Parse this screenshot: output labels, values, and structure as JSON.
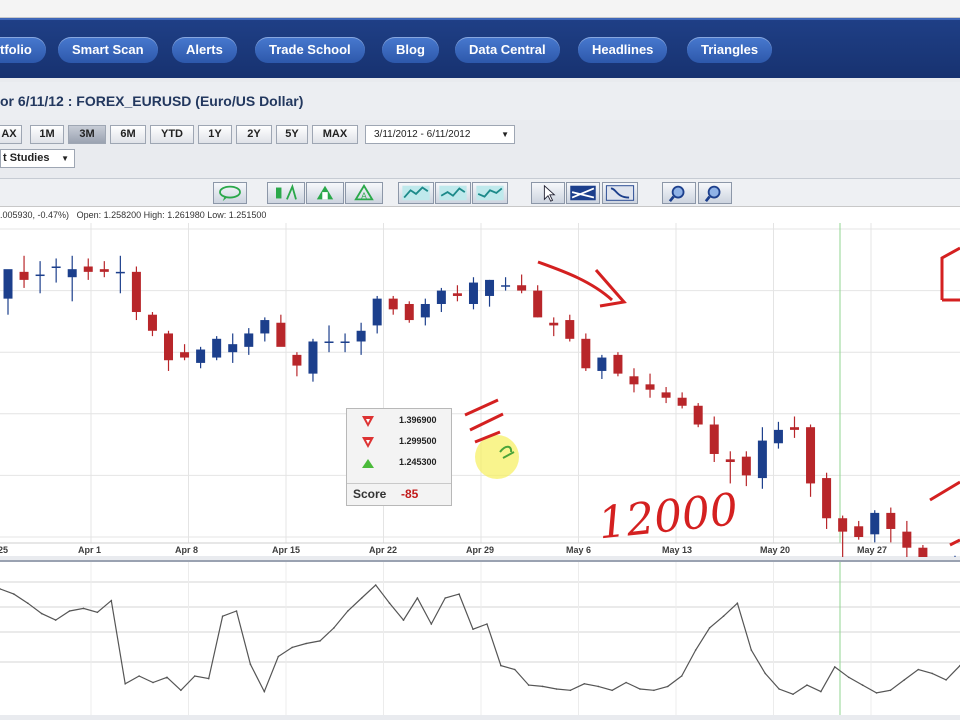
{
  "nav": {
    "items": [
      "tfolio",
      "Smart Scan",
      "Alerts",
      "Trade School",
      "Blog",
      "Data Central",
      "Headlines",
      "Triangles"
    ]
  },
  "header": {
    "title": "or 6/11/12 : FOREX_EURUSD (Euro/US Dollar)"
  },
  "range_buttons": [
    "AX",
    "1M",
    "3M",
    "6M",
    "YTD",
    "1Y",
    "2Y",
    "5Y",
    "MAX"
  ],
  "range_active": "3M",
  "date_range": "3/11/2012 - 6/11/2012",
  "studies_dropdown": "t Studies",
  "quote": {
    "change": ".005930, -0.47%)",
    "open_label": "Open:",
    "open": "1.258200",
    "high_label": "High:",
    "high": "1.261980",
    "low_label": "Low:",
    "low": "1.251500"
  },
  "scorebox": {
    "levels": [
      {
        "icon": "red-down-triangle-icon",
        "value": "1.396900"
      },
      {
        "icon": "red-down-triangle-icon",
        "value": "1.299500"
      },
      {
        "icon": "green-up-triangle-icon",
        "value": "1.245300"
      }
    ],
    "score_label": "Score",
    "score_value": "-85"
  },
  "annotation": {
    "handwritten_text": "12000"
  },
  "colors": {
    "bull_candle": "#1c3f8c",
    "bear_candle": "#b8262a",
    "nav_bg": "#1b3a7d",
    "annotation_red": "#d42020",
    "grid": "#e4e4e4",
    "vline": "#90d690"
  },
  "chart_data": [
    {
      "type": "candlestick",
      "title": "FOREX_EURUSD (Euro/US Dollar)",
      "x_tick_labels": [
        "25",
        "Apr 1",
        "Apr 8",
        "Apr 15",
        "Apr 22",
        "Apr 29",
        "May 6",
        "May 13",
        "May 20",
        "May 27"
      ],
      "y_range": [
        1.24,
        1.355
      ],
      "grid": true,
      "candles": [
        {
          "o": 1.329,
          "h": 1.339,
          "l": 1.323,
          "c": 1.34
        },
        {
          "o": 1.339,
          "h": 1.345,
          "l": 1.333,
          "c": 1.336
        },
        {
          "o": 1.338,
          "h": 1.343,
          "l": 1.331,
          "c": 1.338
        },
        {
          "o": 1.341,
          "h": 1.344,
          "l": 1.335,
          "c": 1.341
        },
        {
          "o": 1.337,
          "h": 1.345,
          "l": 1.328,
          "c": 1.34
        },
        {
          "o": 1.341,
          "h": 1.344,
          "l": 1.336,
          "c": 1.339
        },
        {
          "o": 1.34,
          "h": 1.343,
          "l": 1.337,
          "c": 1.339
        },
        {
          "o": 1.339,
          "h": 1.345,
          "l": 1.331,
          "c": 1.339
        },
        {
          "o": 1.339,
          "h": 1.341,
          "l": 1.321,
          "c": 1.324
        },
        {
          "o": 1.323,
          "h": 1.324,
          "l": 1.315,
          "c": 1.317
        },
        {
          "o": 1.316,
          "h": 1.317,
          "l": 1.302,
          "c": 1.306
        },
        {
          "o": 1.309,
          "h": 1.312,
          "l": 1.306,
          "c": 1.307
        },
        {
          "o": 1.305,
          "h": 1.311,
          "l": 1.303,
          "c": 1.31
        },
        {
          "o": 1.307,
          "h": 1.315,
          "l": 1.306,
          "c": 1.314
        },
        {
          "o": 1.309,
          "h": 1.316,
          "l": 1.305,
          "c": 1.312
        },
        {
          "o": 1.311,
          "h": 1.318,
          "l": 1.308,
          "c": 1.316
        },
        {
          "o": 1.316,
          "h": 1.322,
          "l": 1.313,
          "c": 1.321
        },
        {
          "o": 1.32,
          "h": 1.323,
          "l": 1.313,
          "c": 1.311
        },
        {
          "o": 1.308,
          "h": 1.309,
          "l": 1.3,
          "c": 1.304
        },
        {
          "o": 1.301,
          "h": 1.314,
          "l": 1.298,
          "c": 1.313
        },
        {
          "o": 1.313,
          "h": 1.319,
          "l": 1.309,
          "c": 1.313
        },
        {
          "o": 1.313,
          "h": 1.316,
          "l": 1.309,
          "c": 1.313
        },
        {
          "o": 1.313,
          "h": 1.32,
          "l": 1.308,
          "c": 1.317
        },
        {
          "o": 1.319,
          "h": 1.33,
          "l": 1.316,
          "c": 1.329
        },
        {
          "o": 1.329,
          "h": 1.33,
          "l": 1.323,
          "c": 1.325
        },
        {
          "o": 1.327,
          "h": 1.328,
          "l": 1.32,
          "c": 1.321
        },
        {
          "o": 1.322,
          "h": 1.329,
          "l": 1.319,
          "c": 1.327
        },
        {
          "o": 1.327,
          "h": 1.333,
          "l": 1.324,
          "c": 1.332
        },
        {
          "o": 1.331,
          "h": 1.334,
          "l": 1.328,
          "c": 1.33
        },
        {
          "o": 1.327,
          "h": 1.337,
          "l": 1.325,
          "c": 1.335
        },
        {
          "o": 1.33,
          "h": 1.336,
          "l": 1.326,
          "c": 1.336
        },
        {
          "o": 1.334,
          "h": 1.337,
          "l": 1.332,
          "c": 1.334
        },
        {
          "o": 1.334,
          "h": 1.338,
          "l": 1.331,
          "c": 1.332
        },
        {
          "o": 1.332,
          "h": 1.334,
          "l": 1.322,
          "c": 1.322
        },
        {
          "o": 1.32,
          "h": 1.322,
          "l": 1.315,
          "c": 1.319
        },
        {
          "o": 1.321,
          "h": 1.323,
          "l": 1.313,
          "c": 1.314
        },
        {
          "o": 1.314,
          "h": 1.316,
          "l": 1.302,
          "c": 1.303
        },
        {
          "o": 1.302,
          "h": 1.308,
          "l": 1.299,
          "c": 1.307
        },
        {
          "o": 1.308,
          "h": 1.309,
          "l": 1.3,
          "c": 1.301
        },
        {
          "o": 1.3,
          "h": 1.303,
          "l": 1.294,
          "c": 1.297
        },
        {
          "o": 1.297,
          "h": 1.301,
          "l": 1.292,
          "c": 1.295
        },
        {
          "o": 1.294,
          "h": 1.296,
          "l": 1.29,
          "c": 1.292
        },
        {
          "o": 1.292,
          "h": 1.294,
          "l": 1.288,
          "c": 1.289
        },
        {
          "o": 1.289,
          "h": 1.29,
          "l": 1.281,
          "c": 1.282
        },
        {
          "o": 1.282,
          "h": 1.285,
          "l": 1.268,
          "c": 1.271
        },
        {
          "o": 1.269,
          "h": 1.272,
          "l": 1.26,
          "c": 1.268
        },
        {
          "o": 1.27,
          "h": 1.272,
          "l": 1.259,
          "c": 1.263
        },
        {
          "o": 1.262,
          "h": 1.281,
          "l": 1.258,
          "c": 1.276
        },
        {
          "o": 1.275,
          "h": 1.283,
          "l": 1.273,
          "c": 1.28
        },
        {
          "o": 1.281,
          "h": 1.285,
          "l": 1.277,
          "c": 1.28
        },
        {
          "o": 1.281,
          "h": 1.282,
          "l": 1.255,
          "c": 1.26
        },
        {
          "o": 1.262,
          "h": 1.264,
          "l": 1.243,
          "c": 1.247
        },
        {
          "o": 1.247,
          "h": 1.248,
          "l": 1.232,
          "c": 1.242
        },
        {
          "o": 1.244,
          "h": 1.246,
          "l": 1.239,
          "c": 1.24
        },
        {
          "o": 1.241,
          "h": 1.25,
          "l": 1.238,
          "c": 1.249
        },
        {
          "o": 1.249,
          "h": 1.251,
          "l": 1.238,
          "c": 1.243
        },
        {
          "o": 1.242,
          "h": 1.246,
          "l": 1.232,
          "c": 1.236
        },
        {
          "o": 1.236,
          "h": 1.237,
          "l": 1.225,
          "c": 1.227
        },
        {
          "o": 1.224,
          "h": 1.226,
          "l": 1.216,
          "c": 1.22
        },
        {
          "o": 1.22,
          "h": 1.233,
          "l": 1.218,
          "c": 1.232
        }
      ]
    },
    {
      "type": "line",
      "title": "",
      "y_range": [
        0,
        100
      ],
      "grid": true,
      "series": [
        {
          "values": [
            87,
            83,
            76,
            68,
            63,
            70,
            72,
            69,
            78,
            14,
            20,
            15,
            19,
            9,
            20,
            18,
            66,
            70,
            29,
            8,
            35,
            42,
            45,
            47,
            57,
            70,
            80,
            90,
            76,
            63,
            80,
            60,
            80,
            83,
            56,
            60,
            28,
            25,
            13,
            12,
            10,
            9,
            14,
            12,
            9,
            15,
            10,
            9,
            12,
            20,
            40,
            57,
            66,
            76,
            40,
            22,
            10,
            6,
            13,
            8,
            27,
            19,
            13,
            7,
            9,
            17,
            25,
            22,
            17,
            28
          ]
        }
      ]
    }
  ]
}
